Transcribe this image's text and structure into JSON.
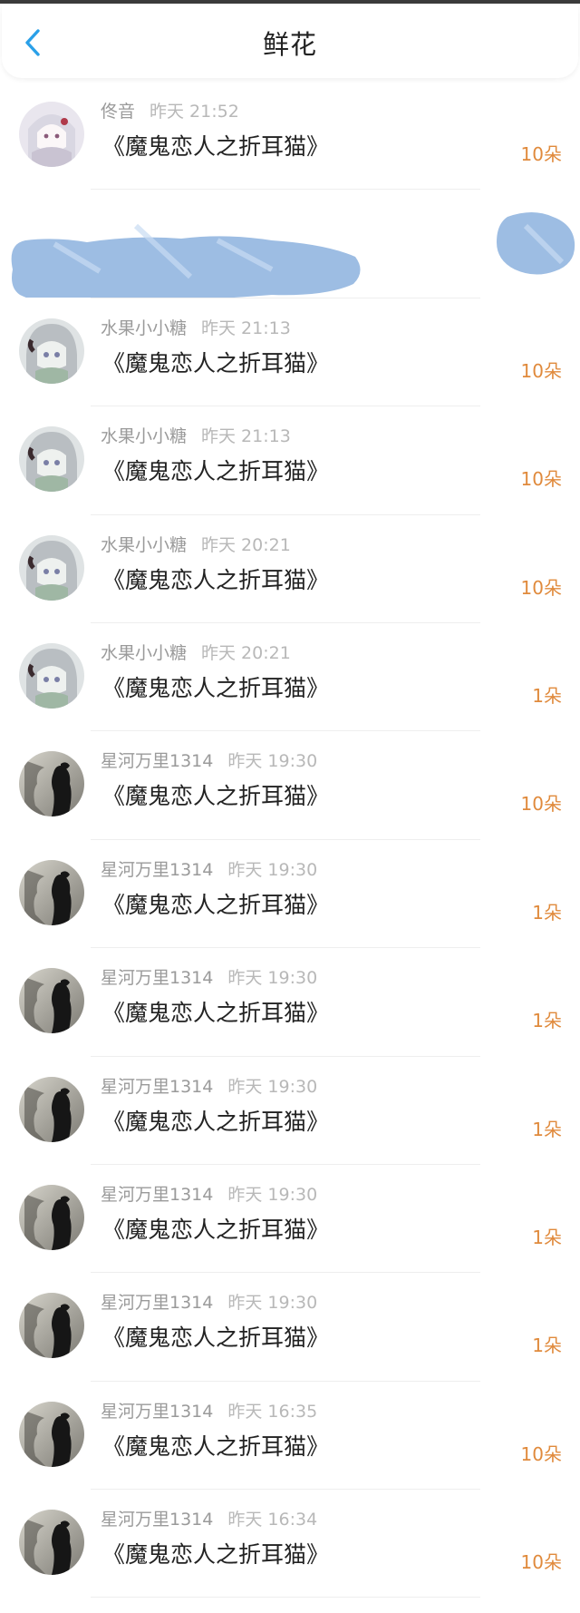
{
  "header": {
    "title": "鲜花",
    "back_icon": "chevron-left-icon",
    "accent": "#2aa0e8"
  },
  "count_color": "#e08a3c",
  "rows": [
    {
      "name": "佟音",
      "time": "昨天 21:52",
      "book": "《魔鬼恋人之折耳猫》",
      "count": "10朵",
      "avatar": "anime-white"
    },
    {
      "name": "",
      "time": "",
      "book": "",
      "count": "",
      "avatar": "redacted"
    },
    {
      "name": "水果小小糖",
      "time": "昨天 21:13",
      "book": "《魔鬼恋人之折耳猫》",
      "count": "10朵",
      "avatar": "anime-gray"
    },
    {
      "name": "水果小小糖",
      "time": "昨天 21:13",
      "book": "《魔鬼恋人之折耳猫》",
      "count": "10朵",
      "avatar": "anime-gray"
    },
    {
      "name": "水果小小糖",
      "time": "昨天 20:21",
      "book": "《魔鬼恋人之折耳猫》",
      "count": "10朵",
      "avatar": "anime-gray"
    },
    {
      "name": "水果小小糖",
      "time": "昨天 20:21",
      "book": "《魔鬼恋人之折耳猫》",
      "count": "1朵",
      "avatar": "anime-gray"
    },
    {
      "name": "星河万里1314",
      "time": "昨天 19:30",
      "book": "《魔鬼恋人之折耳猫》",
      "count": "10朵",
      "avatar": "silhouette"
    },
    {
      "name": "星河万里1314",
      "time": "昨天 19:30",
      "book": "《魔鬼恋人之折耳猫》",
      "count": "1朵",
      "avatar": "silhouette"
    },
    {
      "name": "星河万里1314",
      "time": "昨天 19:30",
      "book": "《魔鬼恋人之折耳猫》",
      "count": "1朵",
      "avatar": "silhouette"
    },
    {
      "name": "星河万里1314",
      "time": "昨天 19:30",
      "book": "《魔鬼恋人之折耳猫》",
      "count": "1朵",
      "avatar": "silhouette"
    },
    {
      "name": "星河万里1314",
      "time": "昨天 19:30",
      "book": "《魔鬼恋人之折耳猫》",
      "count": "1朵",
      "avatar": "silhouette"
    },
    {
      "name": "星河万里1314",
      "time": "昨天 19:30",
      "book": "《魔鬼恋人之折耳猫》",
      "count": "1朵",
      "avatar": "silhouette"
    },
    {
      "name": "星河万里1314",
      "time": "昨天 16:35",
      "book": "《魔鬼恋人之折耳猫》",
      "count": "10朵",
      "avatar": "silhouette"
    },
    {
      "name": "星河万里1314",
      "time": "昨天 16:34",
      "book": "《魔鬼恋人之折耳猫》",
      "count": "10朵",
      "avatar": "silhouette"
    }
  ]
}
